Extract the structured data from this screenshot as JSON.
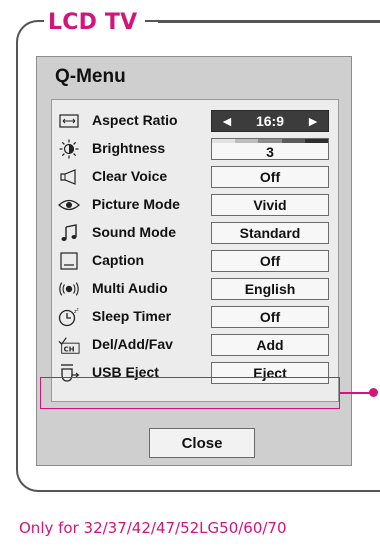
{
  "frame": {
    "title": "LCD TV"
  },
  "qmenu": {
    "title": "Q-Menu",
    "items": [
      {
        "label": "Aspect Ratio",
        "value": "16:9",
        "icon": "aspect-ratio-icon",
        "left_arrow": "◄",
        "right_arrow": "►"
      },
      {
        "label": "Brightness",
        "value": "3",
        "icon": "brightness-icon"
      },
      {
        "label": "Clear Voice",
        "value": "Off",
        "icon": "clear-voice-icon"
      },
      {
        "label": "Picture Mode",
        "value": "Vivid",
        "icon": "picture-mode-icon"
      },
      {
        "label": "Sound Mode",
        "value": "Standard",
        "icon": "sound-mode-icon"
      },
      {
        "label": "Caption",
        "value": "Off",
        "icon": "caption-icon"
      },
      {
        "label": "Multi Audio",
        "value": "English",
        "icon": "multi-audio-icon"
      },
      {
        "label": "Sleep Timer",
        "value": "Off",
        "icon": "sleep-timer-icon"
      },
      {
        "label": "Del/Add/Fav",
        "value": "Add",
        "icon": "del-add-fav-icon"
      },
      {
        "label": "USB Eject",
        "value": "Eject",
        "icon": "usb-eject-icon"
      }
    ],
    "close_label": "Close"
  },
  "footnote": "Only for 32/37/42/47/52LG50/60/70",
  "colors": {
    "accent": "#d4147a",
    "panel": "#cfcfcf",
    "selected": "#3c3c3c"
  }
}
